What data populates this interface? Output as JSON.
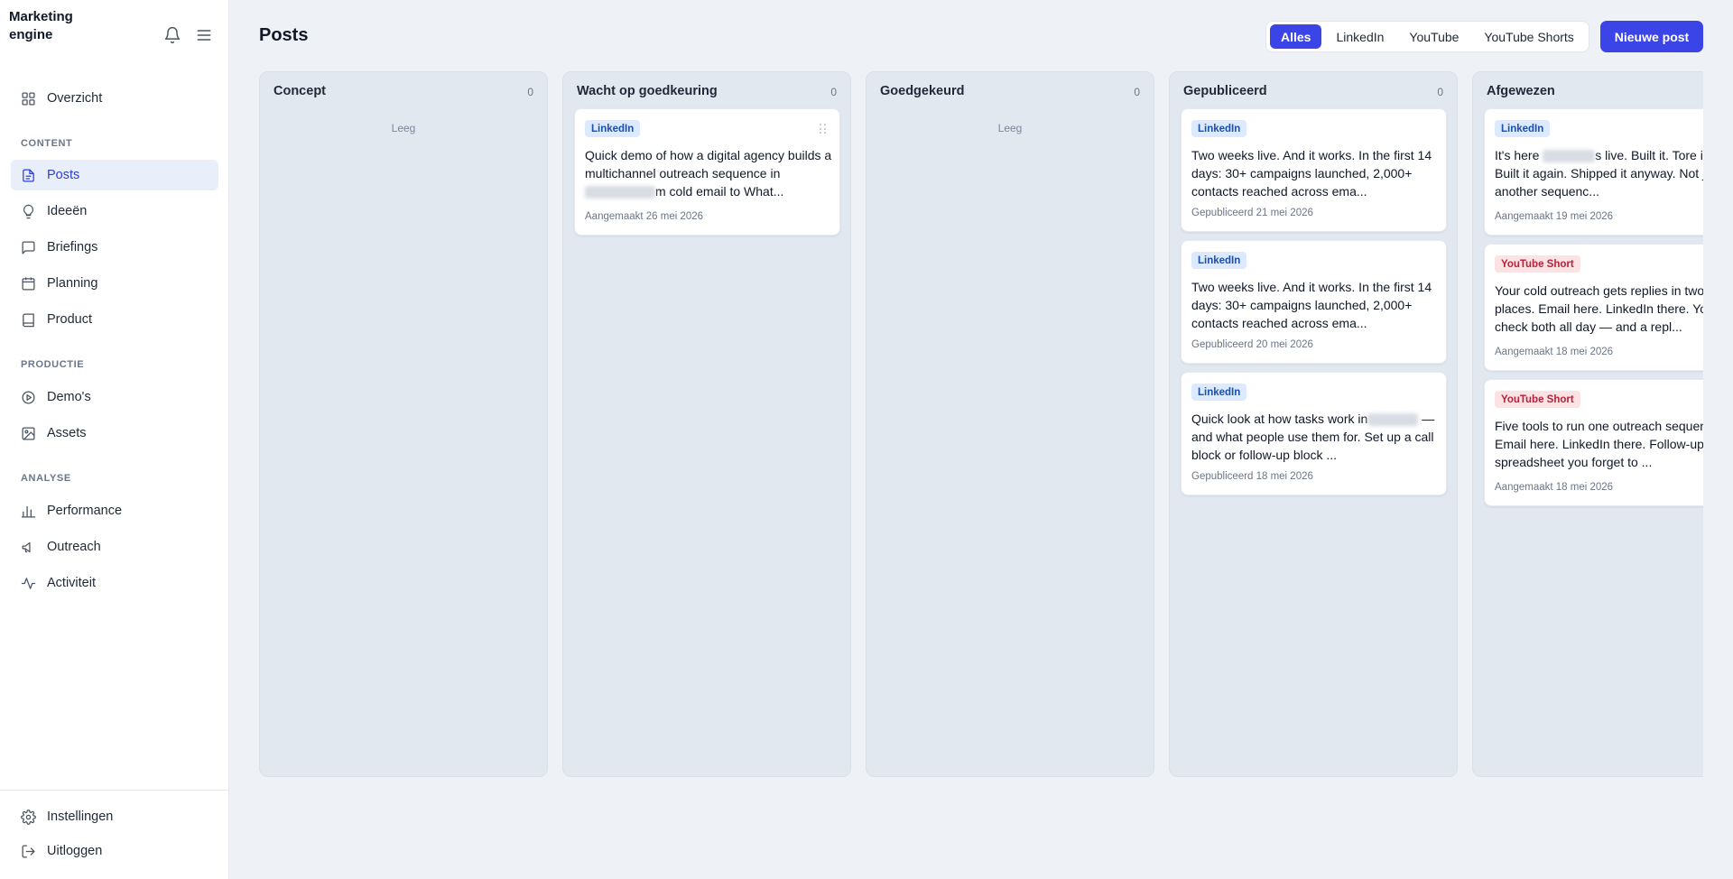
{
  "app": {
    "brand": "Marketing engine"
  },
  "sidebar": {
    "top_items": [
      {
        "label": "Overzicht"
      }
    ],
    "sections": [
      {
        "label": "CONTENT",
        "items": [
          {
            "label": "Posts",
            "active": true
          },
          {
            "label": "Ideeën"
          },
          {
            "label": "Briefings"
          },
          {
            "label": "Planning"
          },
          {
            "label": "Product"
          }
        ]
      },
      {
        "label": "PRODUCTIE",
        "items": [
          {
            "label": "Demo's"
          },
          {
            "label": "Assets"
          }
        ]
      },
      {
        "label": "ANALYSE",
        "items": [
          {
            "label": "Performance"
          },
          {
            "label": "Outreach"
          },
          {
            "label": "Activiteit"
          }
        ]
      }
    ],
    "bottom_items": [
      {
        "label": "Instellingen"
      },
      {
        "label": "Uitloggen"
      }
    ]
  },
  "header": {
    "title": "Posts",
    "filters": [
      "Alles",
      "LinkedIn",
      "YouTube",
      "YouTube Shorts"
    ],
    "active_filter": "Alles",
    "new_post_label": "Nieuwe post"
  },
  "board": {
    "empty_label": "Leeg",
    "columns": [
      {
        "title": "Concept",
        "count": "0",
        "cards": []
      },
      {
        "title": "Wacht op goedkeuring",
        "count": "0",
        "cards": [
          {
            "platform": "LinkedIn",
            "body_a": "Quick demo of how a digital agency builds a multichannel outreach sequence in",
            "body_b": "m cold email to What...",
            "date": "Aangemaakt 26 mei 2026"
          }
        ]
      },
      {
        "title": "Goedgekeurd",
        "count": "0",
        "cards": []
      },
      {
        "title": "Gepubliceerd",
        "count": "0",
        "cards": [
          {
            "platform": "LinkedIn",
            "body": "Two weeks live. And it works. In the first 14 days: 30+ campaigns launched, 2,000+ contacts reached across ema...",
            "date": "Gepubliceerd 21 mei 2026"
          },
          {
            "platform": "LinkedIn",
            "body": "Two weeks live. And it works. In the first 14 days: 30+ campaigns launched, 2,000+ contacts reached across ema...",
            "date": "Gepubliceerd 20 mei 2026"
          },
          {
            "platform": "LinkedIn",
            "body_a": "Quick look at how tasks work in",
            "body_b": "— and what people use them for. Set up a call block or follow-up block ...",
            "date": "Gepubliceerd 18 mei 2026"
          }
        ]
      },
      {
        "title": "Afgewezen",
        "count": "",
        "cards": [
          {
            "platform": "LinkedIn",
            "body_a": "It's here",
            "body_b": "s live. Built it. Tore it down. Built it again. Shipped it anyway. Not just another sequenc...",
            "date": "Aangemaakt 19 mei 2026"
          },
          {
            "platform": "YouTube Short",
            "body": "Your cold outreach gets replies in two places. Email here. LinkedIn there. You check both all day — and a repl...",
            "date": "Aangemaakt 18 mei 2026"
          },
          {
            "platform": "YouTube Short",
            "body": "Five tools to run one outreach sequence. Email here. LinkedIn there. Follow-ups in a spreadsheet you forget to ...",
            "date": "Aangemaakt 18 mei 2026"
          }
        ]
      }
    ]
  },
  "colors": {
    "accent": "#3b44e6",
    "active_nav_bg": "#e9eefb",
    "linkedin_badge": "#dbeafe",
    "youtube_badge": "#fde2e4"
  }
}
